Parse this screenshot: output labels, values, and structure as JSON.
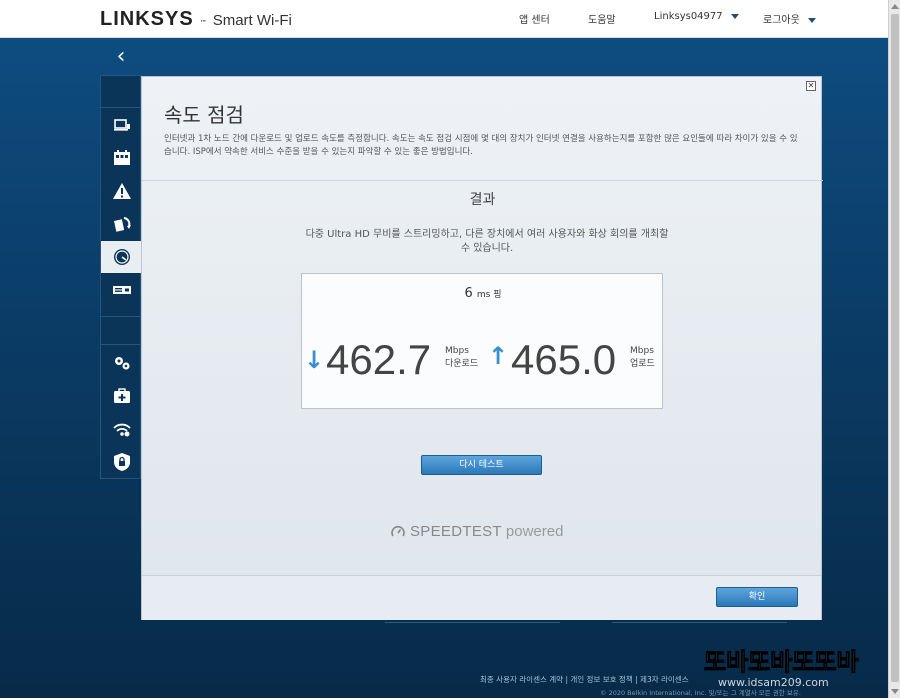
{
  "header": {
    "brand": "LINKSYS",
    "trademark": "™",
    "product": "Smart Wi-Fi",
    "nav": {
      "app_center": "앱 센터",
      "help": "도움말",
      "router_name": "Linksys04977",
      "logout": "로그아웃"
    }
  },
  "sidebar": {
    "back": "‹",
    "items": [
      {
        "icon": "network-map-icon"
      },
      {
        "icon": "devices-calendar-icon"
      },
      {
        "icon": "alert-triangle-icon"
      },
      {
        "icon": "update-arrows-icon"
      },
      {
        "icon": "speedometer-icon",
        "active": true
      },
      {
        "icon": "external-storage-icon"
      },
      {
        "icon": "settings-gears-icon"
      },
      {
        "icon": "troubleshooting-kit-icon"
      },
      {
        "icon": "wifi-settings-icon"
      },
      {
        "icon": "security-shield-icon"
      }
    ]
  },
  "modal": {
    "close": "✕",
    "title": "속도 점검",
    "description": "인터넷과 1차 노드 간에 다운로드 및 업로드 속도를 측정합니다. 속도는 속도 점검 시점에 몇 대의 장치가 인터넷 연결을 사용하는지를 포함한 많은 요인들에 따라 차이가 있을 수 있습니다. ISP에서 약속한 서비스 수준을 받을 수 있는지 파악할 수 있는 좋은 방법입니다.",
    "result_title": "결과",
    "result_desc": "다중 Ultra HD 무비를 스트리밍하고, 다른 장치에서 여러 사용자와 화상 회의를 개최할 수 있습니다.",
    "ping_value": "6",
    "ping_unit": "ms 핑",
    "download": {
      "arrow": "↓",
      "value": "462.7",
      "unit": "Mbps",
      "label": "다운로드"
    },
    "upload": {
      "arrow": "↑",
      "value": "465.0",
      "unit": "Mbps",
      "label": "업로드"
    },
    "retest_label": "다시 테스트",
    "speedtest_text": "SPEEDTEST",
    "speedtest_powered": "powered",
    "ok_label": "확인"
  },
  "footer": {
    "eula": "최종 사용자 라이센스 계약",
    "sep1": "|",
    "privacy": "개인 정보 보호 정책",
    "sep2": "|",
    "third_party": "제3자 라이센스",
    "copyright": "© 2020 Belkin International, Inc. 및/또는 그 계열사 모든 권한 보유."
  },
  "watermark": {
    "text": "또바또바또또바",
    "url": "www.idsam209.com"
  },
  "colors": {
    "accent": "#3a8fd0",
    "button": "#2b78b8",
    "page_bg": "#0b3c66"
  }
}
